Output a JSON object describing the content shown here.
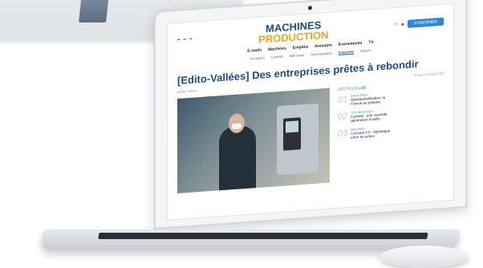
{
  "site": {
    "brand_line1": "MACHINES",
    "brand_line2": "PRODUCTION",
    "header_button": "S'ABONNER",
    "nav_primary": [
      "E-mails",
      "Machines",
      "Emplois",
      "Annuaire",
      "Événements",
      "TV"
    ],
    "nav_secondary": [
      "Formation",
      "Contrôle",
      "Métrologie",
      "Automatisation",
      "Industries",
      "Ateliers"
    ],
    "active_secondary": "Industries",
    "headline": "[Edito-Vallées] Des entreprises prêtes à rebondir",
    "meta_left": "[Edito] Vallées",
    "meta_right": "Publié le 06/11/2020",
    "sidebar_title": "LES PLUS",
    "sidebar_title_accent": "LUS",
    "sidebar_items": [
      {
        "num": "01",
        "cat": "INDUSTRIES",
        "title": "Réindustrialisation: la France se prépare"
      },
      {
        "num": "02",
        "cat": "TECHNOLOGIES",
        "title": "Carbide : une nouvelle génération d'outils"
      },
      {
        "num": "03",
        "cat": "MACHINES",
        "title": "Concept 4.0 : Alphatique entre en action"
      }
    ]
  }
}
